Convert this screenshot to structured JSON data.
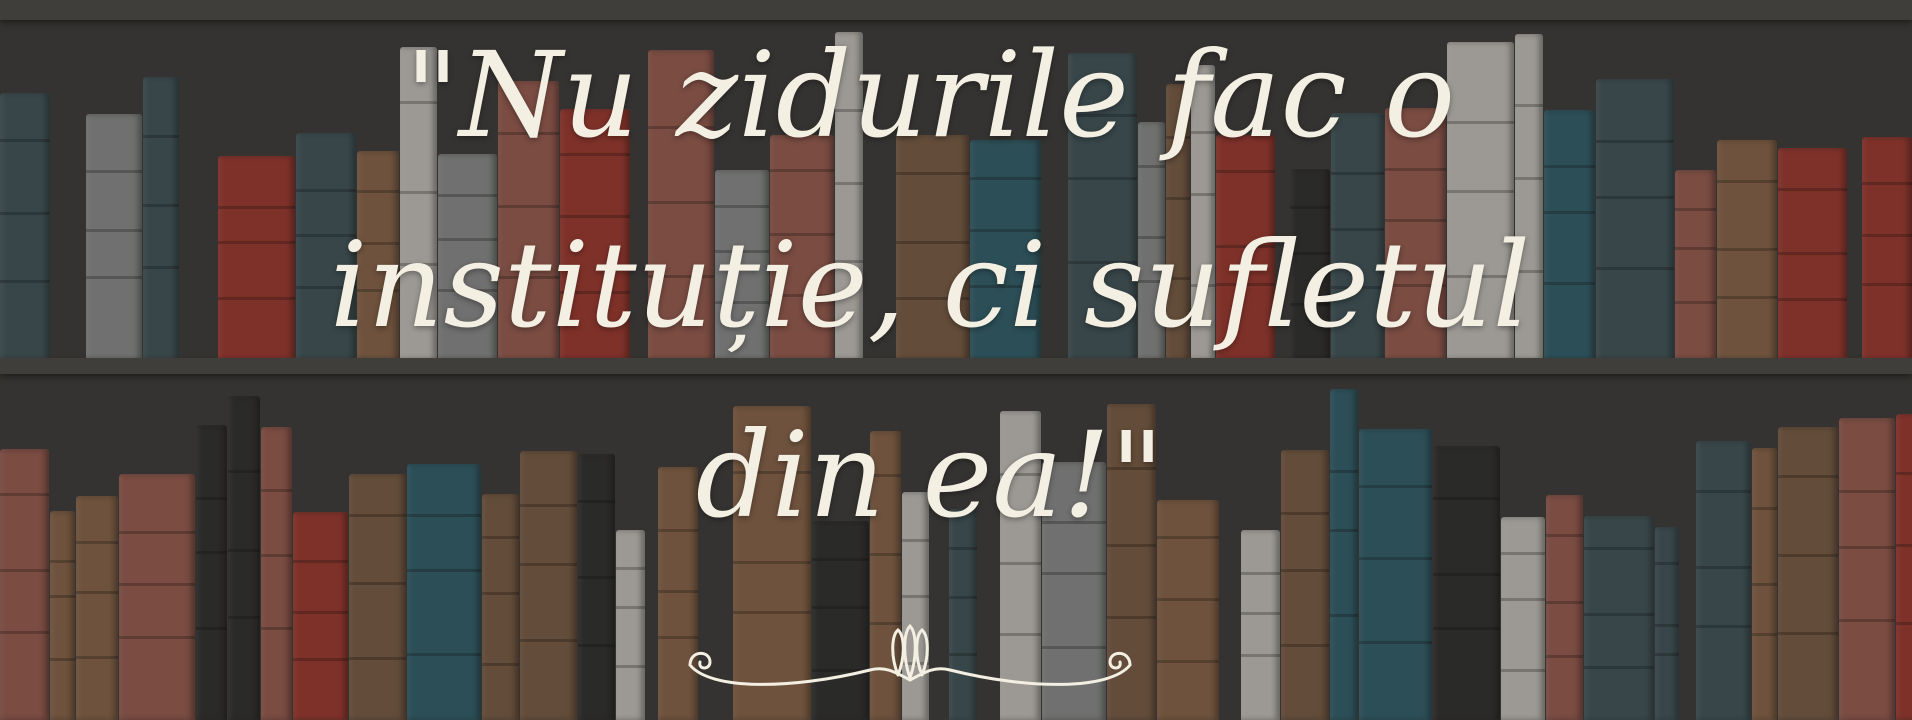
{
  "quote": {
    "lines": [
      "\"Nu zidurile fac o",
      "instituție, ci sufletul",
      "din ea!\""
    ]
  },
  "colors": {
    "text": "#f3efe2",
    "background": "#3a3836",
    "book_palette": [
      "#7a5a42",
      "#3f5358",
      "#8b8d8c",
      "#a0352c",
      "#c9c5bf",
      "#2c2b2a",
      "#8a6347",
      "#2f5e6b",
      "#9a5a4e"
    ]
  },
  "icons": {
    "flourish": "ornamental-flourish-divider"
  }
}
